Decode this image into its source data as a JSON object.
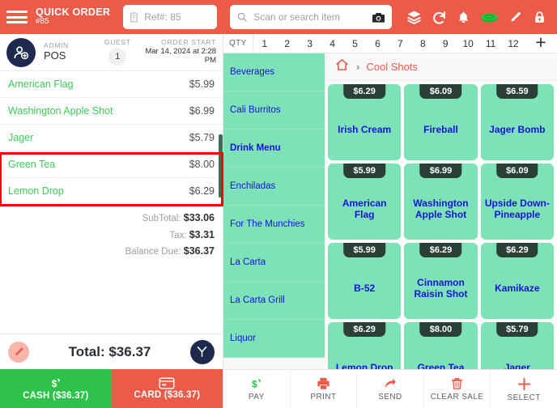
{
  "header": {
    "menu_icon": "hamburger-icon",
    "title": "QUICK ORDER",
    "order_number": "#85",
    "ref_field": {
      "value": "Ref#: 85",
      "icon": "note-icon"
    },
    "search_field": {
      "placeholder": "Scan or search item",
      "icon": "search-icon",
      "camera_icon": "camera-icon"
    },
    "icons": [
      "layers-icon",
      "undo-icon",
      "bell-icon",
      "cash-stack-icon",
      "pencil-icon",
      "lock-icon"
    ],
    "background": "#ec5a48"
  },
  "customer_bar": {
    "avatar_icon": "add-user-icon",
    "admin_label": "ADMIN",
    "admin_value": "POS",
    "guest_label": "GUEST",
    "guest_count": "1",
    "order_start_label": "ORDER START",
    "order_start_value": "Mar 14, 2024 at 2:28 PM"
  },
  "order": {
    "items": [
      {
        "name": "American Flag",
        "price": "$5.99"
      },
      {
        "name": "Washington Apple Shot",
        "price": "$6.99"
      },
      {
        "name": "Jager",
        "price": "$5.79"
      },
      {
        "name": "Green Tea",
        "price": "$8.00"
      },
      {
        "name": "Lemon Drop",
        "price": "$6.29"
      }
    ],
    "subtotal_label": "SubTotal:",
    "subtotal_value": "$33.06",
    "tax_label": "Tax:",
    "tax_value": "$3.31",
    "balance_label": "Balance Due:",
    "balance_value": "$36.37",
    "total_text": "Total: $36.37",
    "edit_icon": "pencil-icon",
    "split_icon": "split-check-icon",
    "item_name_color": "#3ecb5a"
  },
  "pay_buttons": {
    "cash": {
      "label": "CASH ($36.37)",
      "icon": "cash-icon",
      "color": "#2ec24a"
    },
    "card": {
      "label": "CARD ($36.37)",
      "icon": "credit-card-icon",
      "color": "#ec5a48"
    }
  },
  "qty_bar": {
    "label": "QTY",
    "values": [
      "1",
      "2",
      "3",
      "4",
      "5",
      "6",
      "7",
      "8",
      "9",
      "10",
      "11",
      "12"
    ],
    "plus_icon": "plus-icon"
  },
  "categories": [
    {
      "label": "Beverages",
      "selected": false
    },
    {
      "label": "Cali Burritos",
      "selected": false
    },
    {
      "label": "Drink Menu",
      "selected": true
    },
    {
      "label": "Enchiladas",
      "selected": false
    },
    {
      "label": "For The Munchies",
      "selected": false
    },
    {
      "label": "La Carta",
      "selected": false
    },
    {
      "label": "La Carta Grill",
      "selected": false
    },
    {
      "label": "Liquor",
      "selected": false
    }
  ],
  "breadcrumb": {
    "home_icon": "home-icon",
    "separator": "›",
    "current": "Cool Shots"
  },
  "products": [
    {
      "name": "Irish Cream",
      "price": "$6.29"
    },
    {
      "name": "Fireball",
      "price": "$6.09"
    },
    {
      "name": "Jager Bomb",
      "price": "$6.59"
    },
    {
      "name": "American Flag",
      "price": "$5.99"
    },
    {
      "name": "Washington Apple Shot",
      "price": "$6.99"
    },
    {
      "name": "Upside Down-Pineapple",
      "price": "$6.09"
    },
    {
      "name": "B-52",
      "price": "$5.99"
    },
    {
      "name": "Cinnamon Raisin Shot",
      "price": "$6.29"
    },
    {
      "name": "Kamikaze",
      "price": "$6.29"
    },
    {
      "name": "Lemon Drop",
      "price": "$6.29"
    },
    {
      "name": "Green Tea",
      "price": "$8.00"
    },
    {
      "name": "Jager",
      "price": "$5.79"
    }
  ],
  "toolbar": [
    {
      "label": "PAY",
      "icon": "cash-icon",
      "color": "#2ec24a"
    },
    {
      "label": "PRINT",
      "icon": "printer-icon",
      "color": "#ec5a48"
    },
    {
      "label": "SEND",
      "icon": "arrow-share-icon",
      "color": "#ec5a48"
    },
    {
      "label": "CLEAR SALE",
      "icon": "trash-icon",
      "color": "#ec5a48"
    },
    {
      "label": "SELECT",
      "icon": "plus-icon",
      "color": "#ec5a48"
    }
  ],
  "annotation": {
    "color": "#ff0000",
    "target": "green-tea-and-lemon-drop-order-rows"
  },
  "theme": {
    "tile_green": "#7ee2b8",
    "price_badge": "#2a3f36",
    "product_blue": "#1414d8",
    "accent_red": "#ec5a48"
  }
}
